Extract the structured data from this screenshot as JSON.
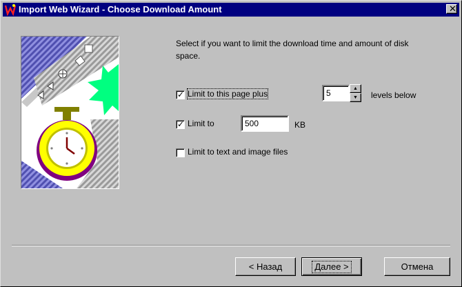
{
  "window": {
    "title": "Import Web Wizard - Choose Download Amount",
    "close_glyph": "✕"
  },
  "description": "Select if you want to limit the download time and amount of disk space.",
  "options": {
    "limit_page": {
      "label": "Limit to this page plus",
      "checked": true,
      "check_glyph": "✓"
    },
    "levels_value": "5",
    "levels_suffix": "levels below",
    "limit_size": {
      "label": "Limit to",
      "checked": true,
      "check_glyph": "✓"
    },
    "size_value": "500",
    "size_unit": "KB",
    "limit_types": {
      "label": "Limit to text and image files",
      "checked": false,
      "check_glyph": ""
    }
  },
  "spinner": {
    "up_glyph": "▲",
    "down_glyph": "▼"
  },
  "buttons": {
    "back": "< Назад",
    "next": "Далее >",
    "cancel": "Отмена"
  },
  "colors": {
    "title_bar": "#000080",
    "face": "#c0c0c0",
    "stopwatch": "#ffff00",
    "stopwatch_ring": "#800080",
    "starburst": "#00ff80"
  }
}
